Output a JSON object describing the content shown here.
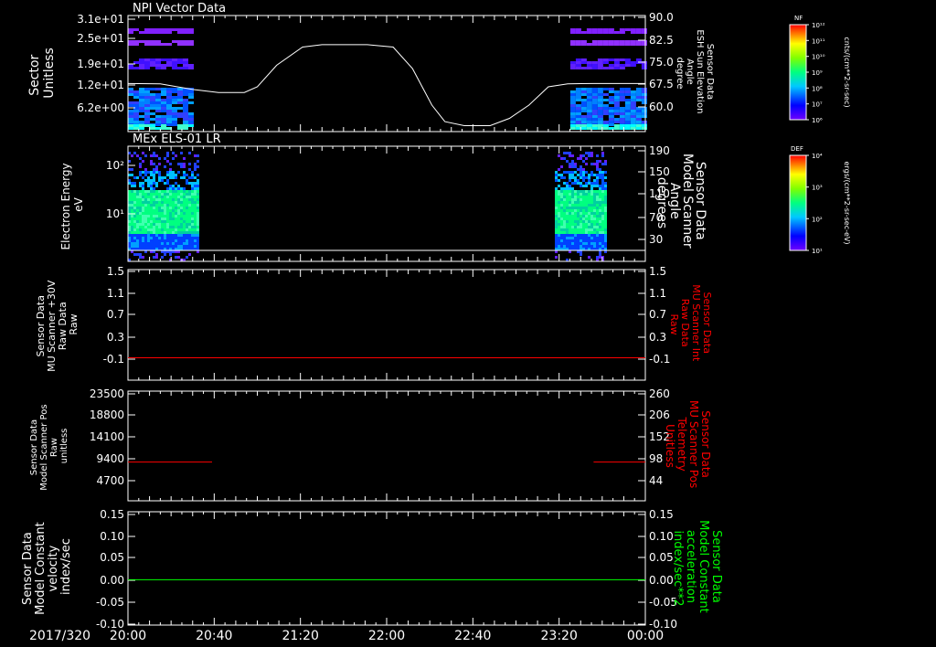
{
  "time_axis": {
    "date_label": "2017/320",
    "ticks": [
      "20:00",
      "20:40",
      "21:20",
      "22:00",
      "22:40",
      "23:20",
      "00:00"
    ],
    "range_hours": [
      20.0,
      24.0
    ]
  },
  "colors": {
    "background": "#000000",
    "axes": "#ffffff",
    "red_trace": "#ff0000",
    "green_trace": "#00ff00"
  },
  "chart_data": [
    {
      "type": "heatmap",
      "id": "panel1",
      "title": "NPI Vector Data",
      "ylabel_left": [
        "Sector",
        "Unitless"
      ],
      "ylabel_right": [
        "Sensor Data",
        "ESH Sun Elevation",
        "Angle",
        "degree"
      ],
      "left_ticks": [
        "3.1e+01",
        "2.5e+01",
        "1.9e+01",
        "1.2e+01",
        "6.2e+00"
      ],
      "right_ticks": [
        "90.0",
        "82.5",
        "75.0",
        "67.5",
        "60.0"
      ],
      "right_range": [
        55,
        90
      ],
      "data_intervals": [
        [
          20.0,
          20.5
        ],
        [
          23.42,
          24.0
        ]
      ],
      "line": {
        "color": "#ffffff",
        "points": [
          [
            20.0,
            69.5
          ],
          [
            20.25,
            69.4
          ],
          [
            20.5,
            67.7
          ],
          [
            20.7,
            66.8
          ],
          [
            20.9,
            66.8
          ],
          [
            21.0,
            68.5
          ],
          [
            21.15,
            75.0
          ],
          [
            21.35,
            80.5
          ],
          [
            21.5,
            81.2
          ],
          [
            21.85,
            81.2
          ],
          [
            22.05,
            80.5
          ],
          [
            22.2,
            74.0
          ],
          [
            22.35,
            63.0
          ],
          [
            22.45,
            58.0
          ],
          [
            22.6,
            56.8
          ],
          [
            22.8,
            56.8
          ],
          [
            22.95,
            59.0
          ],
          [
            23.1,
            63.0
          ],
          [
            23.25,
            68.5
          ],
          [
            23.4,
            69.4
          ],
          [
            23.6,
            69.5
          ],
          [
            24.0,
            69.5
          ]
        ]
      },
      "colorbar": {
        "label": "NF",
        "unit": "cnts/(cm**2-sr-sec)",
        "ticks": [
          "10¹²",
          "10¹¹",
          "10¹⁰",
          "10⁹",
          "10⁸",
          "10⁷",
          "10⁶"
        ]
      }
    },
    {
      "type": "heatmap",
      "id": "panel2",
      "title": "MEx ELS-01 LR",
      "ylabel_left": [
        "Electron Energy",
        "eV"
      ],
      "ylabel_right": [
        "Sensor Data",
        "Model Scanner",
        "Angle",
        "degrees"
      ],
      "left_ticks": [
        "10²",
        "10¹"
      ],
      "right_ticks": [
        "190",
        "150",
        "110",
        "70",
        "30"
      ],
      "right_range": [
        10,
        190
      ],
      "data_intervals": [
        [
          20.0,
          20.55
        ],
        [
          23.3,
          23.7
        ]
      ],
      "colorbar": {
        "label": "DEF",
        "unit": "ergs/(cm**2-sr-sec-eV)",
        "ticks": [
          "10⁴",
          "10³",
          "10²",
          "10¹"
        ]
      }
    },
    {
      "type": "line",
      "id": "panel3",
      "ylabel_left": [
        "Sensor Data",
        "MU Scanner +30V",
        "Raw Data",
        "Raw"
      ],
      "ylabel_right": [
        "Sensor Data",
        "MU Scanner Int",
        "Raw Data",
        "Raw"
      ],
      "left_ticks": [
        "1.5",
        "1.1",
        "0.7",
        "0.3",
        "-0.1"
      ],
      "right_ticks": [
        "1.5",
        "1.1",
        "0.7",
        "0.3",
        "-0.1"
      ],
      "ylim": [
        -0.38,
        1.5
      ],
      "series": [
        {
          "color": "#ff0000",
          "segments": [
            [
              [
                20.0,
                0.0
              ],
              [
                24.0,
                0.0
              ]
            ]
          ]
        }
      ]
    },
    {
      "type": "line",
      "id": "panel4",
      "ylabel_left": [
        "Sensor Data",
        "Model Scanner Pos",
        "Raw",
        "unitless"
      ],
      "ylabel_right": [
        "Sensor Data",
        "MU Scanner Pos",
        "Telemetry",
        "Unitless"
      ],
      "left_ticks": [
        "23500",
        "18800",
        "14100",
        "9400",
        "4700"
      ],
      "right_ticks": [
        "260",
        "206",
        "152",
        "98",
        "44"
      ],
      "ylim": [
        0,
        23500
      ],
      "series": [
        {
          "color": "#ff0000",
          "segments": [
            [
              [
                20.0,
                8300
              ],
              [
                20.65,
                8300
              ]
            ],
            [
              [
                23.6,
                8300
              ],
              [
                24.0,
                8300
              ]
            ]
          ]
        }
      ]
    },
    {
      "type": "line",
      "id": "panel5",
      "ylabel_left": [
        "Sensor Data",
        "Model Constant",
        "velocity",
        "index/sec"
      ],
      "ylabel_right": [
        "Sensor Data",
        "Model Constant",
        "acceleration",
        "index/sec**2"
      ],
      "left_ticks": [
        "0.15",
        "0.10",
        "0.05",
        "0.00",
        "-0.05",
        "-0.10"
      ],
      "right_ticks": [
        "0.15",
        "0.10",
        "0.05",
        "0.00",
        "-0.05",
        "-0.10"
      ],
      "ylim": [
        -0.1,
        0.15
      ],
      "series": [
        {
          "color": "#00ff00",
          "segments": [
            [
              [
                20.0,
                0.0
              ],
              [
                24.0,
                0.0
              ]
            ]
          ]
        }
      ]
    }
  ]
}
